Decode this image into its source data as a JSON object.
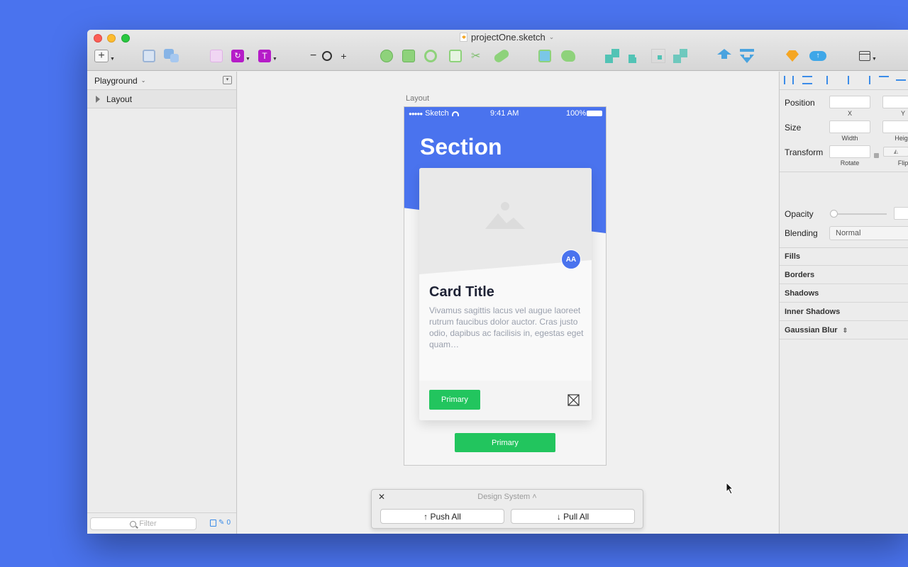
{
  "window": {
    "title": "projectOne.sketch"
  },
  "layers": {
    "page_name": "Playground",
    "items": [
      {
        "label": "Layout"
      }
    ],
    "filter_placeholder": "Filter",
    "badge_count": "0"
  },
  "artboard": {
    "label": "Layout",
    "status": {
      "carrier": "Sketch",
      "time": "9:41 AM",
      "battery": "100%"
    },
    "section_title": "Section",
    "card": {
      "title": "Card Title",
      "body": "Vivamus sagittis lacus vel augue laoreet rutrum faucibus dolor auctor. Cras justo odio, dapibus ac facilisis in, egestas eget quam…",
      "avatar": "AA",
      "button_label": "Primary"
    },
    "bottom_button_label": "Primary"
  },
  "design_system": {
    "title": "Design System",
    "push_label": "↑ Push All",
    "pull_label": "↓ Pull All"
  },
  "inspector": {
    "position_label": "Position",
    "x_label": "X",
    "y_label": "Y",
    "size_label": "Size",
    "width_label": "Width",
    "height_label": "Heigh",
    "transform_label": "Transform",
    "rotate_label": "Rotate",
    "flip_label": "Flip",
    "opacity_label": "Opacity",
    "blending_label": "Blending",
    "blending_value": "Normal",
    "sections": [
      "Fills",
      "Borders",
      "Shadows",
      "Inner Shadows",
      "Gaussian Blur"
    ]
  },
  "colors": {
    "brand_blue": "#4a73ee",
    "primary_green": "#22c55e"
  }
}
